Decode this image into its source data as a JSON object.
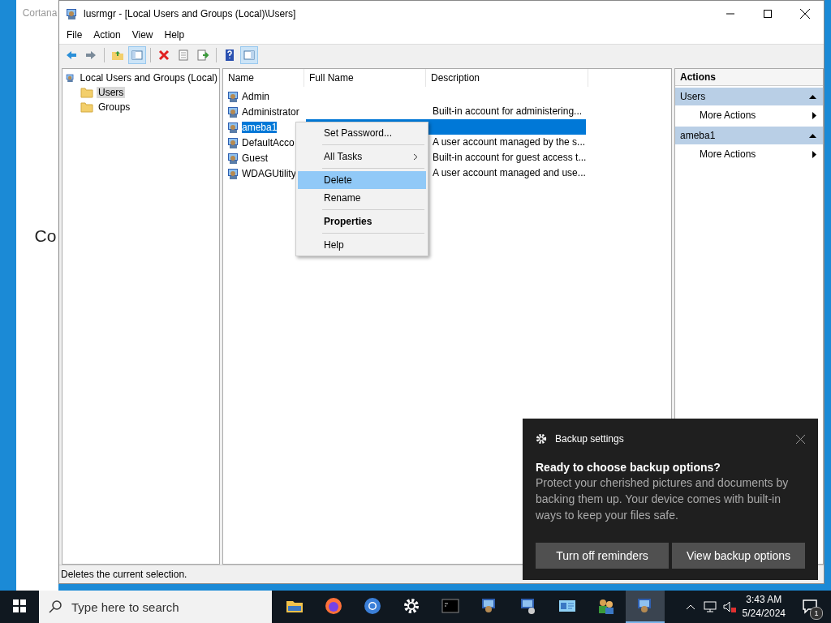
{
  "desktop": {
    "side_panel_title": "Cortana",
    "side_panel_text": "Co"
  },
  "window": {
    "title": "lusrmgr - [Local Users and Groups (Local)\\Users]"
  },
  "menu_bar": [
    "File",
    "Action",
    "View",
    "Help"
  ],
  "toolbar": [
    {
      "kind": "back",
      "pressed": false
    },
    {
      "kind": "forward",
      "pressed": false
    },
    {
      "kind": "separator"
    },
    {
      "kind": "up",
      "pressed": false
    },
    {
      "kind": "tree",
      "pressed": true
    },
    {
      "kind": "separator"
    },
    {
      "kind": "delete",
      "pressed": false
    },
    {
      "kind": "properties",
      "pressed": false
    },
    {
      "kind": "export",
      "pressed": false
    },
    {
      "kind": "separator"
    },
    {
      "kind": "help",
      "pressed": false
    },
    {
      "kind": "actionpane",
      "pressed": true
    }
  ],
  "tree": {
    "label": "Local Users and Groups (Local)",
    "children": [
      {
        "label": "Users",
        "selected": true
      },
      {
        "label": "Groups",
        "selected": false
      }
    ]
  },
  "list": {
    "columns": [
      "Name",
      "Full Name",
      "Description"
    ],
    "rows": [
      {
        "name": "Admin",
        "selected": false
      },
      {
        "name": "Administrator",
        "description": "Built-in account for administering...",
        "selected": false
      },
      {
        "name": "ameba1",
        "selected": true
      },
      {
        "name": "DefaultAcco",
        "description": "A user account managed by the s...",
        "selected": false
      },
      {
        "name": "Guest",
        "description": "Built-in account for guest access t...",
        "selected": false
      },
      {
        "name": "WDAGUtility",
        "description": "A user account managed and use...",
        "selected": false
      }
    ]
  },
  "context_menu": {
    "groups": [
      [
        {
          "label": "Set Password...",
          "submenu": false,
          "bold": false,
          "highlighted": false
        }
      ],
      [
        {
          "label": "All Tasks",
          "submenu": true,
          "bold": false,
          "highlighted": false
        }
      ],
      [
        {
          "label": "Delete",
          "submenu": false,
          "bold": false,
          "highlighted": true
        },
        {
          "label": "Rename",
          "submenu": false,
          "bold": false,
          "highlighted": false
        }
      ],
      [
        {
          "label": "Properties",
          "submenu": false,
          "bold": true,
          "highlighted": false
        }
      ],
      [
        {
          "label": "Help",
          "submenu": false,
          "bold": false,
          "highlighted": false
        }
      ]
    ]
  },
  "actions_pane": {
    "title": "Actions",
    "sections": [
      {
        "title": "Users",
        "items": [
          "More Actions"
        ]
      },
      {
        "title": "ameba1",
        "items": [
          "More Actions"
        ]
      }
    ]
  },
  "status_bar": "Deletes the current selection.",
  "toast": {
    "app": "Backup settings",
    "heading": "Ready to choose backup options?",
    "body": "Protect your cherished pictures and documents by backing them up. Your device comes with built-in ways to keep your files safe.",
    "buttons": [
      "Turn off reminders",
      "View backup options"
    ]
  },
  "taskbar": {
    "search_placeholder": "Type here to search",
    "apps": [
      {
        "kind": "explorer",
        "active": false
      },
      {
        "kind": "firefox",
        "active": false
      },
      {
        "kind": "chrome",
        "active": false
      },
      {
        "kind": "settings",
        "active": false
      },
      {
        "kind": "terminal",
        "active": false
      },
      {
        "kind": "computer",
        "active": false
      },
      {
        "kind": "computer-disk",
        "active": false
      },
      {
        "kind": "control-panel",
        "active": false
      },
      {
        "kind": "users",
        "active": false
      },
      {
        "kind": "computer",
        "active": true
      }
    ],
    "time": "3:43 AM",
    "date": "5/24/2024",
    "notification_count": "1"
  }
}
